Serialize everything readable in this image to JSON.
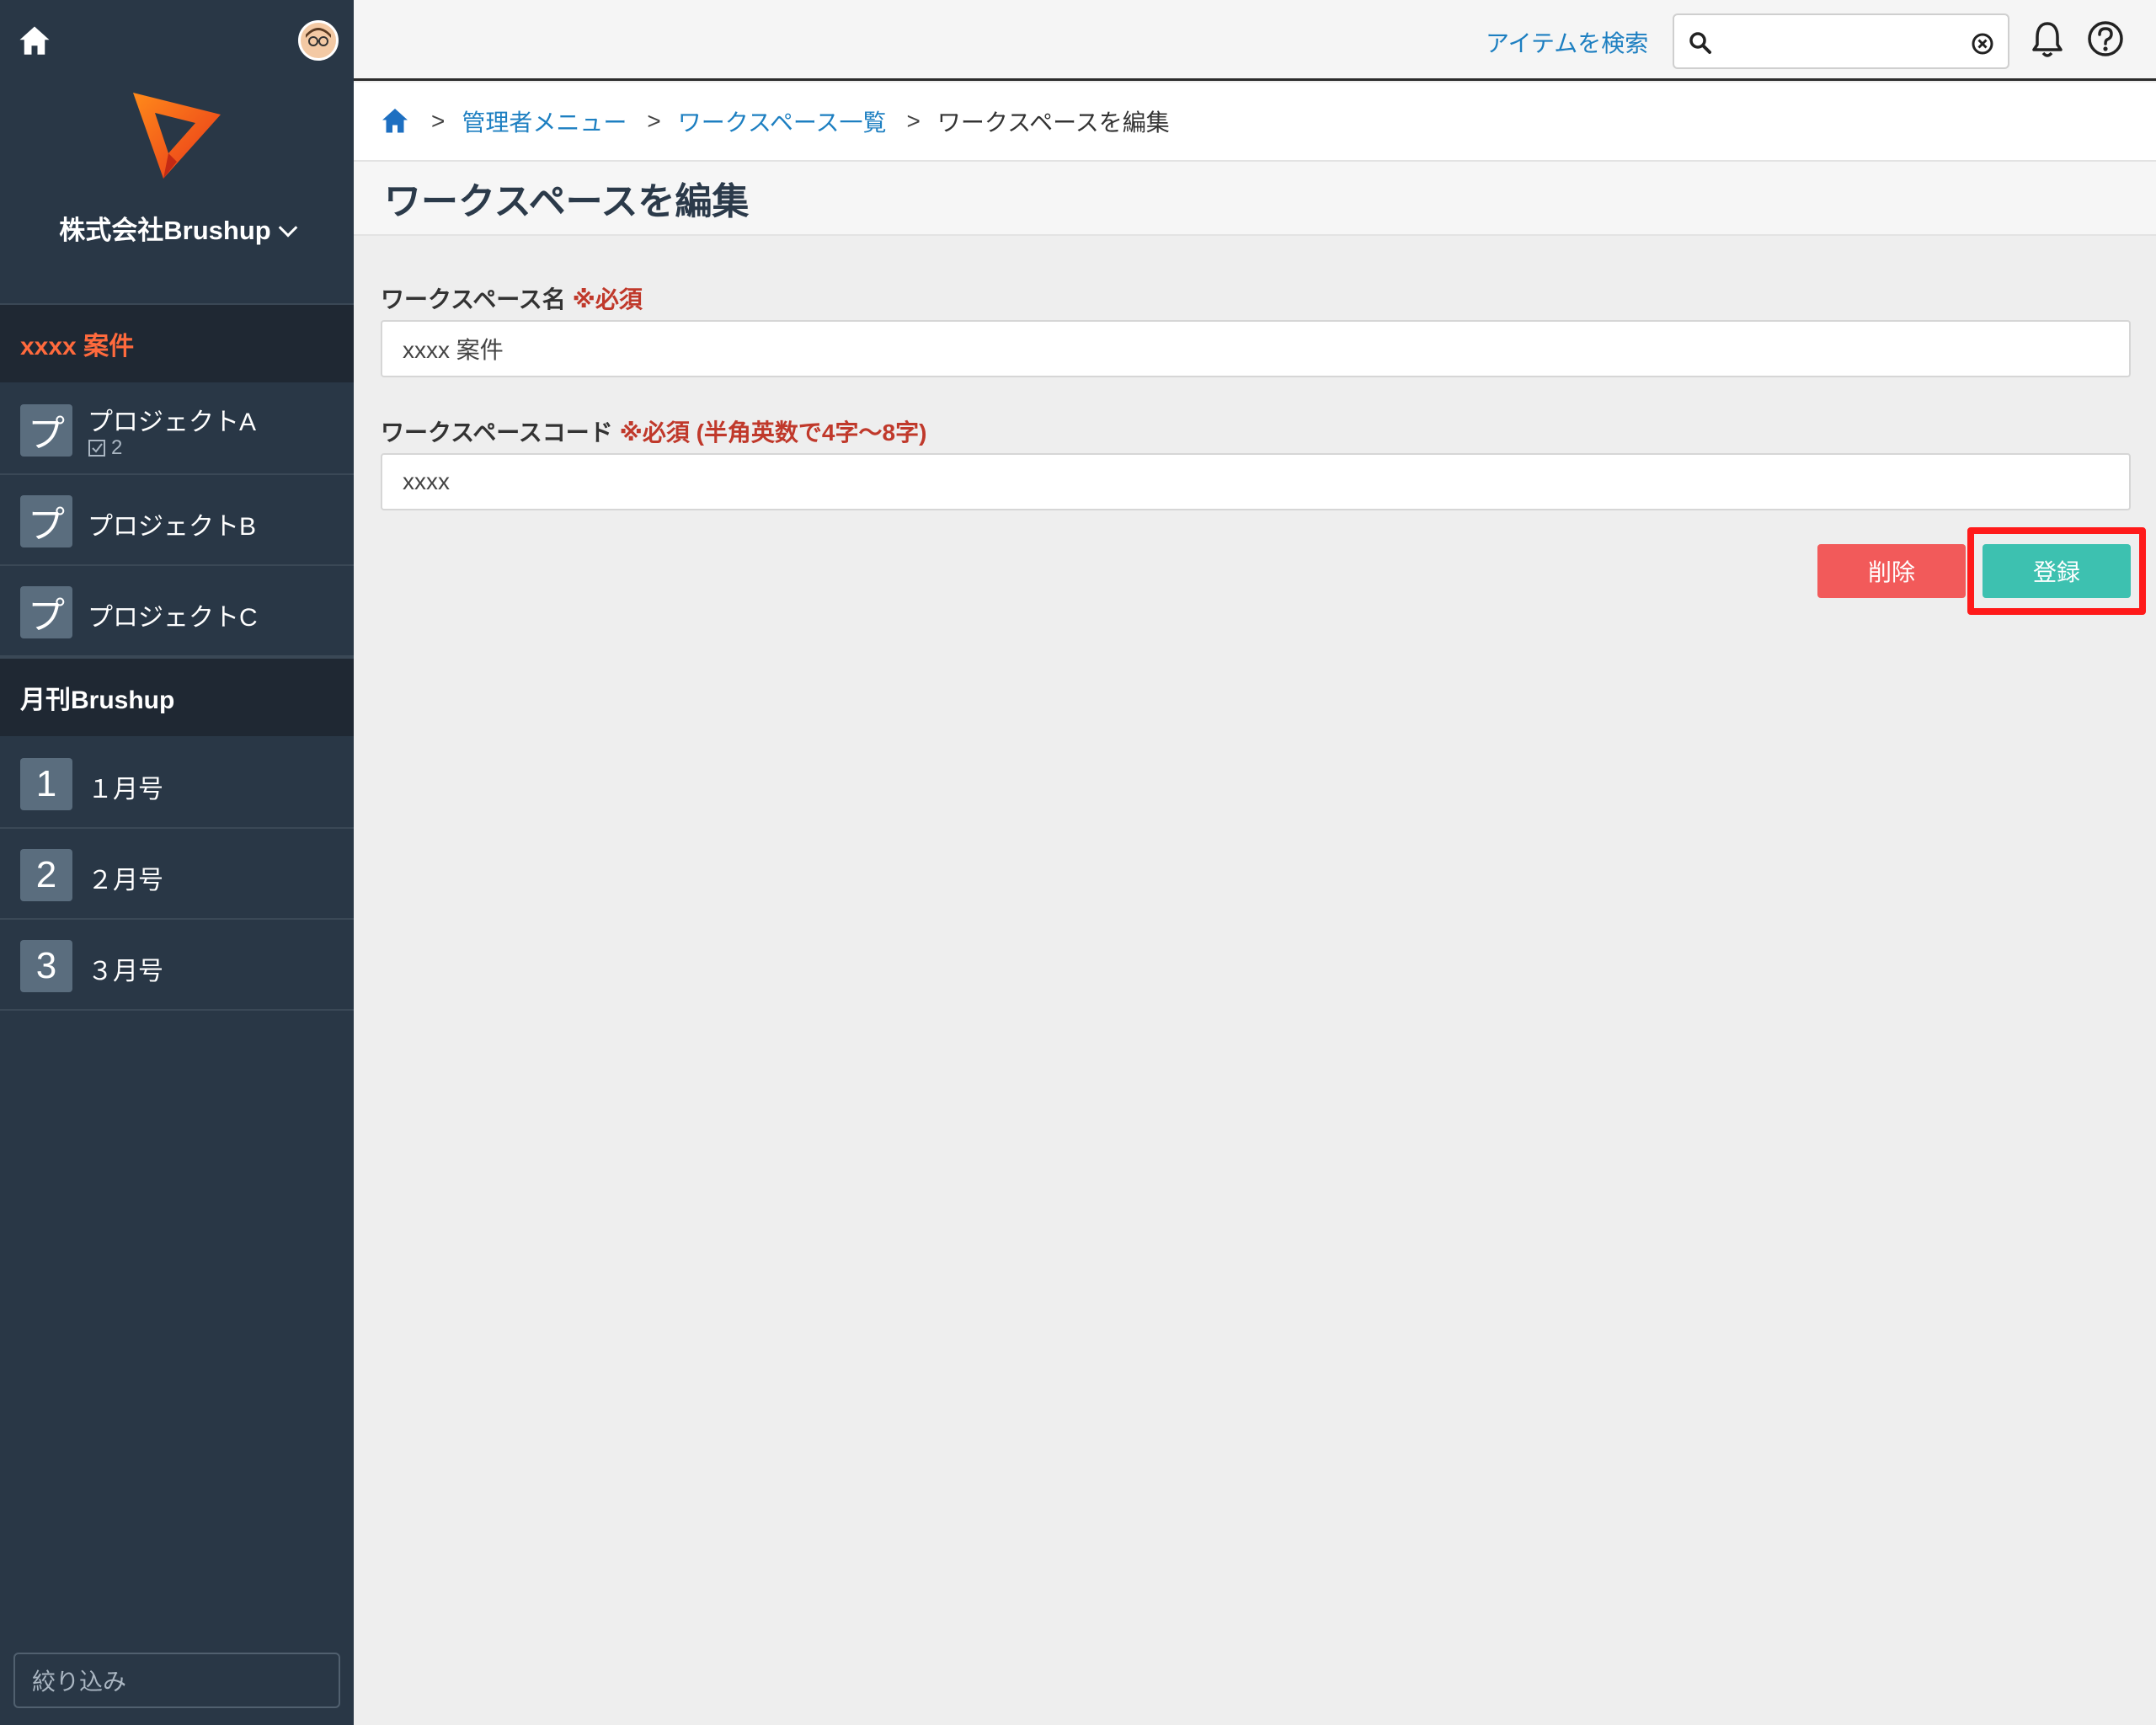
{
  "sidebar": {
    "company_name": "株式会社Brushup",
    "workspaces": [
      {
        "name": "xxxx 案件",
        "items": [
          {
            "badge": "プ",
            "label": "プロジェクトA",
            "count": "2"
          },
          {
            "badge": "プ",
            "label": "プロジェクトB"
          },
          {
            "badge": "プ",
            "label": "プロジェクトC"
          }
        ]
      },
      {
        "name": "月刊Brushup",
        "items": [
          {
            "badge": "1",
            "label": "１月号"
          },
          {
            "badge": "2",
            "label": "２月号"
          },
          {
            "badge": "3",
            "label": "３月号"
          }
        ]
      }
    ],
    "filter_placeholder": "絞り込み"
  },
  "topbar": {
    "search_link": "アイテムを検索",
    "search_value": ""
  },
  "breadcrumb": {
    "items": [
      "管理者メニュー",
      "ワークスペース一覧"
    ],
    "current": "ワークスペースを編集",
    "separator": ">"
  },
  "page": {
    "title": "ワークスペースを編集"
  },
  "form": {
    "name_label": "ワークスペース名",
    "name_required": "※必須",
    "name_value": "xxxx 案件",
    "code_label": "ワークスペースコード",
    "code_required": "※必須 (半角英数で4字〜8字)",
    "code_value": "xxxx"
  },
  "buttons": {
    "delete": "削除",
    "register": "登録"
  },
  "colors": {
    "sidebar_bg": "#293746",
    "active_workspace": "#ff6a3d",
    "link": "#1d7fc1",
    "required": "#c0392b",
    "delete": "#f25a5a",
    "register": "#3dc1b0",
    "highlight": "#ff1a1a"
  }
}
